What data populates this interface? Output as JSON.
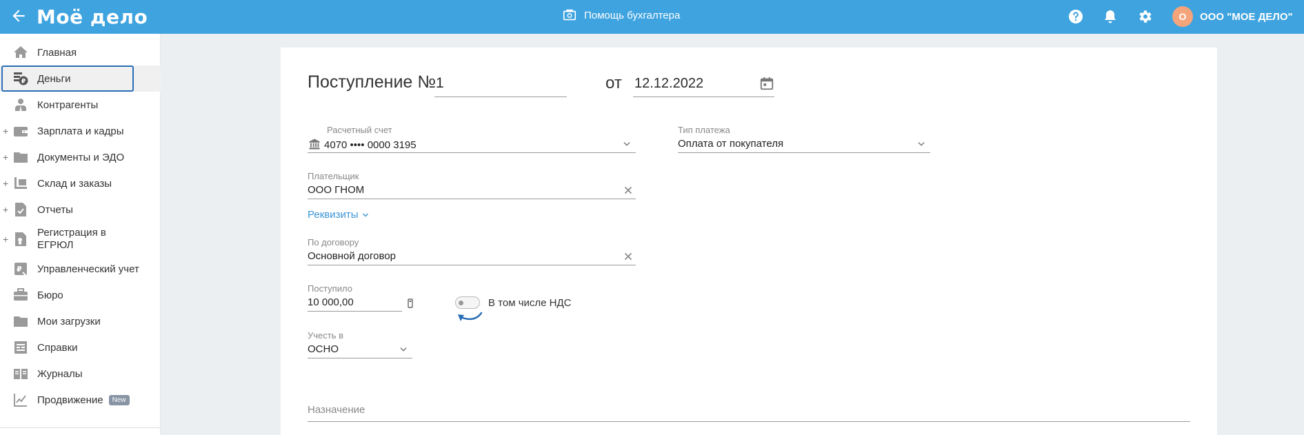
{
  "header": {
    "logo": "Моё дело",
    "help_label": "Помощь бухгалтера",
    "org_initial": "О",
    "org_name": "ООО \"МОЕ ДЕЛО\"",
    "colors": {
      "bar": "#3ea3df",
      "avatar": "#f4a47b"
    }
  },
  "sidebar": {
    "items": [
      {
        "label": "Главная",
        "icon": "home-icon",
        "expandable": false
      },
      {
        "label": "Деньги",
        "icon": "money-icon",
        "expandable": false,
        "active": true
      },
      {
        "label": "Контрагенты",
        "icon": "contractor-icon",
        "expandable": false
      },
      {
        "label": "Зарплата и кадры",
        "icon": "wallet-icon",
        "expandable": true
      },
      {
        "label": "Документы и ЭДО",
        "icon": "folder-icon",
        "expandable": true
      },
      {
        "label": "Склад и заказы",
        "icon": "cart-icon",
        "expandable": true
      },
      {
        "label": "Отчеты",
        "icon": "report-icon",
        "expandable": true
      },
      {
        "label": "Регистрация в ЕГРЮЛ",
        "label_line1": "Регистрация в",
        "label_line2": "ЕГРЮЛ",
        "icon": "registration-icon",
        "expandable": true
      },
      {
        "label": "Управленческий учет",
        "icon": "management-icon",
        "expandable": false
      },
      {
        "label": "Бюро",
        "icon": "briefcase-icon",
        "expandable": false
      },
      {
        "label": "Мои загрузки",
        "icon": "downloads-folder-icon",
        "expandable": false
      },
      {
        "label": "Справки",
        "icon": "reference-icon",
        "expandable": false
      },
      {
        "label": "Журналы",
        "icon": "journal-icon",
        "expandable": false
      },
      {
        "label": "Продвижение",
        "icon": "promotion-icon",
        "expandable": false,
        "badge": "New"
      }
    ]
  },
  "form": {
    "title": "Поступление №",
    "number": "1",
    "date_prefix": "от",
    "date": "12.12.2022",
    "account": {
      "label": "Расчетный счет",
      "value": "4070 •••• 0000 3195"
    },
    "payment_type": {
      "label": "Тип платежа",
      "value": "Оплата от покупателя"
    },
    "payer": {
      "label": "Плательщик",
      "value": "ООО ГНОМ"
    },
    "requisites_link": "Реквизиты",
    "contract": {
      "label": "По договору",
      "value": "Основной договор"
    },
    "amount": {
      "label": "Поступило",
      "value": "10 000,00"
    },
    "vat_toggle": {
      "label": "В том числе НДС",
      "on": false
    },
    "tax_system": {
      "label": "Учесть в",
      "value": "ОСНО"
    },
    "purpose": {
      "placeholder": "Назначение"
    }
  }
}
